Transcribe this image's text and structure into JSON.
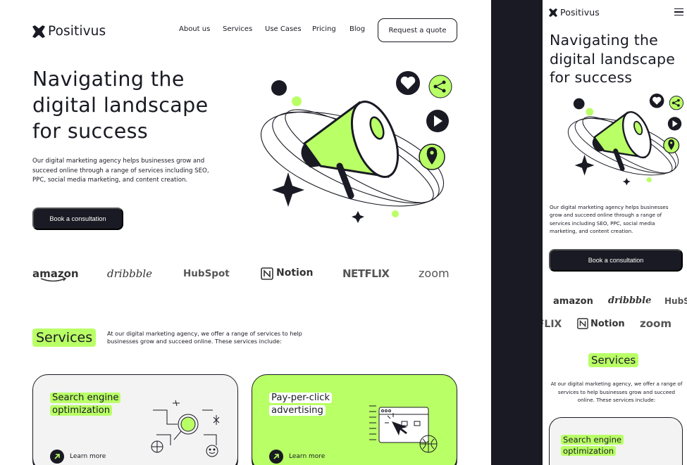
{
  "brand": {
    "name": "Positivus"
  },
  "nav": {
    "items": [
      "About us",
      "Services",
      "Use Cases",
      "Pricing",
      "Blog"
    ],
    "cta": "Request a quote"
  },
  "hero": {
    "title": "Navigating the digital landscape for success",
    "description": "Our digital marketing agency helps businesses grow and succeed online through a range of services including SEO, PPC, social media marketing, and content creation.",
    "cta": "Book a consultation"
  },
  "logos": [
    "amazon",
    "dribbble",
    "HubSpot",
    "Notion",
    "NETFLIX",
    "zoom"
  ],
  "services": {
    "heading": "Services",
    "description": "At our digital marketing agency, we offer a range of services to help businesses grow and succeed online. These services include:",
    "cards": [
      {
        "line1": "Search engine",
        "line2": "optimization",
        "link": "Learn more"
      },
      {
        "line1": "Pay-per-click",
        "line2": "advertising",
        "link": "Learn more"
      }
    ]
  },
  "colors": {
    "accent": "#B9FF66",
    "dark": "#191A23",
    "grey": "#F3F3F3"
  },
  "icons": [
    "positivus-logo-icon",
    "menu-icon",
    "arrow-up-right-icon",
    "megaphone-illustration"
  ]
}
